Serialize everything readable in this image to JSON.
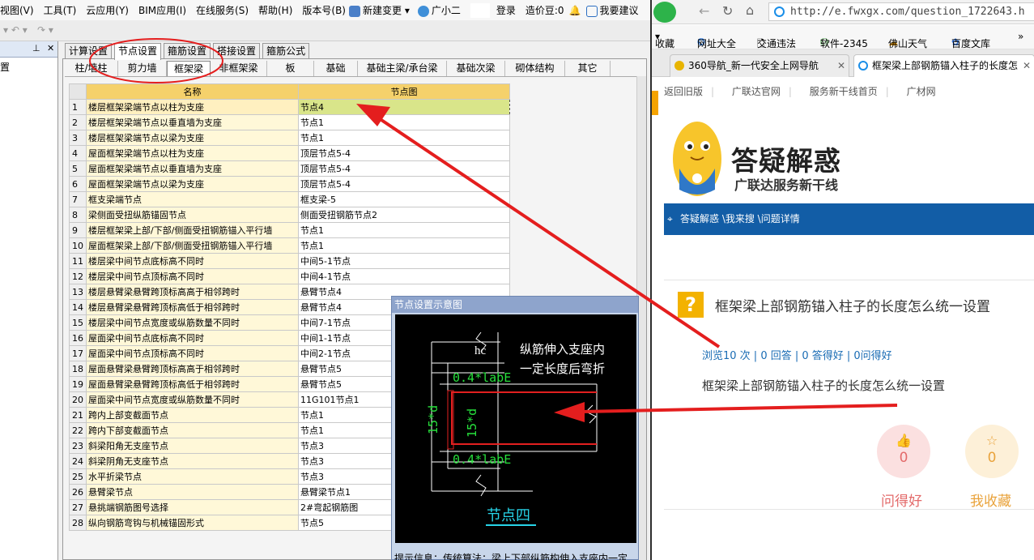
{
  "app": {
    "menu": [
      "视图(V)",
      "工具(T)",
      "云应用(Y)",
      "BIM应用(I)",
      "在线服务(S)",
      "帮助(H)",
      "版本号(B)"
    ],
    "new_change": "新建变更",
    "guangxiaoer": "广小二",
    "login": "登录",
    "cost_beans": "造价豆:0",
    "suggest": "我要建议",
    "tabs_top": [
      "计算设置",
      "节点设置",
      "箍筋设置",
      "搭接设置",
      "箍筋公式"
    ],
    "tabs_sub": [
      "柱/墙柱",
      "剪力墙",
      "框架梁",
      "非框架梁",
      "板",
      "基础",
      "基础主梁/承台梁",
      "基础次梁",
      "砌体结构",
      "其它"
    ],
    "grid_headers": {
      "name": "名称",
      "node": "节点图"
    },
    "rows": [
      {
        "n": "1",
        "name": "楼层框架梁端节点以柱为支座",
        "val": "节点4"
      },
      {
        "n": "2",
        "name": "楼层框架梁端节点以垂直墙为支座",
        "val": "节点1"
      },
      {
        "n": "3",
        "name": "楼层框架梁端节点以梁为支座",
        "val": "节点1"
      },
      {
        "n": "4",
        "name": "屋面框架梁端节点以柱为支座",
        "val": "顶层节点5-4"
      },
      {
        "n": "5",
        "name": "屋面框架梁端节点以垂直墙为支座",
        "val": "顶层节点5-4"
      },
      {
        "n": "6",
        "name": "屋面框架梁端节点以梁为支座",
        "val": "顶层节点5-4"
      },
      {
        "n": "7",
        "name": "框支梁端节点",
        "val": "框支梁-5"
      },
      {
        "n": "8",
        "name": "梁侧面受扭纵筋锚固节点",
        "val": "侧面受扭钢筋节点2"
      },
      {
        "n": "9",
        "name": "楼层框架梁上部/下部/侧面受扭钢筋锚入平行墙",
        "val": "节点1"
      },
      {
        "n": "10",
        "name": "屋面框架梁上部/下部/侧面受扭钢筋锚入平行墙",
        "val": "节点1"
      },
      {
        "n": "11",
        "name": "楼层梁中间节点底标高不同时",
        "val": "中间5-1节点"
      },
      {
        "n": "12",
        "name": "楼层梁中间节点顶标高不同时",
        "val": "中间4-1节点"
      },
      {
        "n": "13",
        "name": "楼层悬臂梁悬臂跨顶标高高于相邻跨时",
        "val": "悬臂节点4"
      },
      {
        "n": "14",
        "name": "楼层悬臂梁悬臂跨顶标高低于相邻跨时",
        "val": "悬臂节点4"
      },
      {
        "n": "15",
        "name": "楼层梁中间节点宽度或纵筋数量不同时",
        "val": "中间7-1节点"
      },
      {
        "n": "16",
        "name": "屋面梁中间节点底标高不同时",
        "val": "中间1-1节点"
      },
      {
        "n": "17",
        "name": "屋面梁中间节点顶标高不同时",
        "val": "中间2-1节点"
      },
      {
        "n": "18",
        "name": "屋面悬臂梁悬臂跨顶标高高于相邻跨时",
        "val": "悬臂节点5"
      },
      {
        "n": "19",
        "name": "屋面悬臂梁悬臂跨顶标高低于相邻跨时",
        "val": "悬臂节点5"
      },
      {
        "n": "20",
        "name": "屋面梁中间节点宽度或纵筋数量不同时",
        "val": "11G101节点1"
      },
      {
        "n": "21",
        "name": "跨内上部变截面节点",
        "val": "节点1"
      },
      {
        "n": "22",
        "name": "跨内下部变截面节点",
        "val": "节点1"
      },
      {
        "n": "23",
        "name": "斜梁阳角无支座节点",
        "val": "节点3"
      },
      {
        "n": "24",
        "name": "斜梁阴角无支座节点",
        "val": "节点3"
      },
      {
        "n": "25",
        "name": "水平折梁节点",
        "val": "节点3"
      },
      {
        "n": "26",
        "name": "悬臂梁节点",
        "val": "悬臂梁节点1"
      },
      {
        "n": "27",
        "name": "悬挑端钢筋图号选择",
        "val": "2#弯起钢筋图"
      },
      {
        "n": "28",
        "name": "纵向钢筋弯钩与机械锚固形式",
        "val": "节点5"
      }
    ],
    "diagram": {
      "title": "节点设置示意图",
      "hc": "hc",
      "note1": "纵筋伸入支座内",
      "note2": "一定长度后弯折",
      "anchor_top": "0.4*labE",
      "anchor_bottom": "0.4*labE",
      "left_dim": "15*d",
      "inner_dim": "15*d",
      "caption": "节点四",
      "tip": "提示信息：传统算法：梁上下部纵筋构伸入支座内一定"
    }
  },
  "browser": {
    "url": "http://e.fwxgx.com/question_1722643.h",
    "bookmarks": [
      "收藏",
      "网址大全",
      "交通违法",
      "软件-2345",
      "佛山天气",
      "百度文库"
    ],
    "tabs": [
      {
        "label": "360导航_新一代安全上网导航"
      },
      {
        "label": "框架梁上部钢筋锚入柱子的长度怎"
      }
    ],
    "site_nav": [
      "返回旧版",
      "广联达官网",
      "服务新干线首页",
      "广材网"
    ],
    "banner_title": "答疑解惑",
    "banner_sub": "广联达服务新干线",
    "breadcrumb": "答疑解惑 \\我来搜 \\问题详情",
    "question_title": "框架梁上部钢筋锚入柱子的长度怎么统一设置",
    "stats": "浏览10 次 | 0 回答 | 0 答得好 | 0问得好",
    "question_body": "框架梁上部钢筋锚入柱子的长度怎么统一设置",
    "like_count": "0",
    "like_label": "问得好",
    "fav_count": "0",
    "fav_label": "我收藏"
  },
  "colors": {
    "annotation_red": "#e41e1e",
    "header_yellow": "#f5d16b",
    "diagram_green": "#27e03c",
    "browser_blue": "#125da6"
  }
}
